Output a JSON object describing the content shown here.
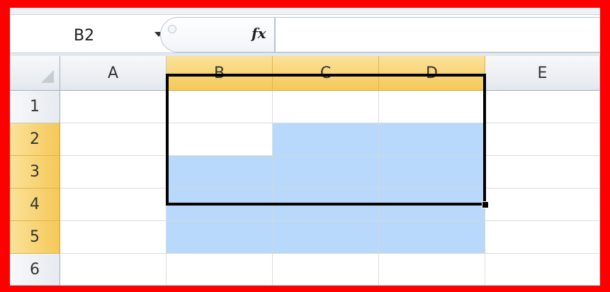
{
  "formula_bar": {
    "name_box": "B2",
    "fx_label": "fx",
    "formula_value": ""
  },
  "sheet": {
    "columns": [
      "A",
      "B",
      "C",
      "D",
      "E"
    ],
    "rows": [
      "1",
      "2",
      "3",
      "4",
      "5",
      "6"
    ],
    "selected_columns": [
      "B",
      "C",
      "D"
    ],
    "selected_rows": [
      "2",
      "3",
      "4",
      "5"
    ],
    "active_cell": "B2",
    "selection_range": "B2:D5",
    "highlight_color": "#b8d9fb",
    "header_highlight_color": "#f5c858"
  },
  "frame_color": "#ff0000"
}
